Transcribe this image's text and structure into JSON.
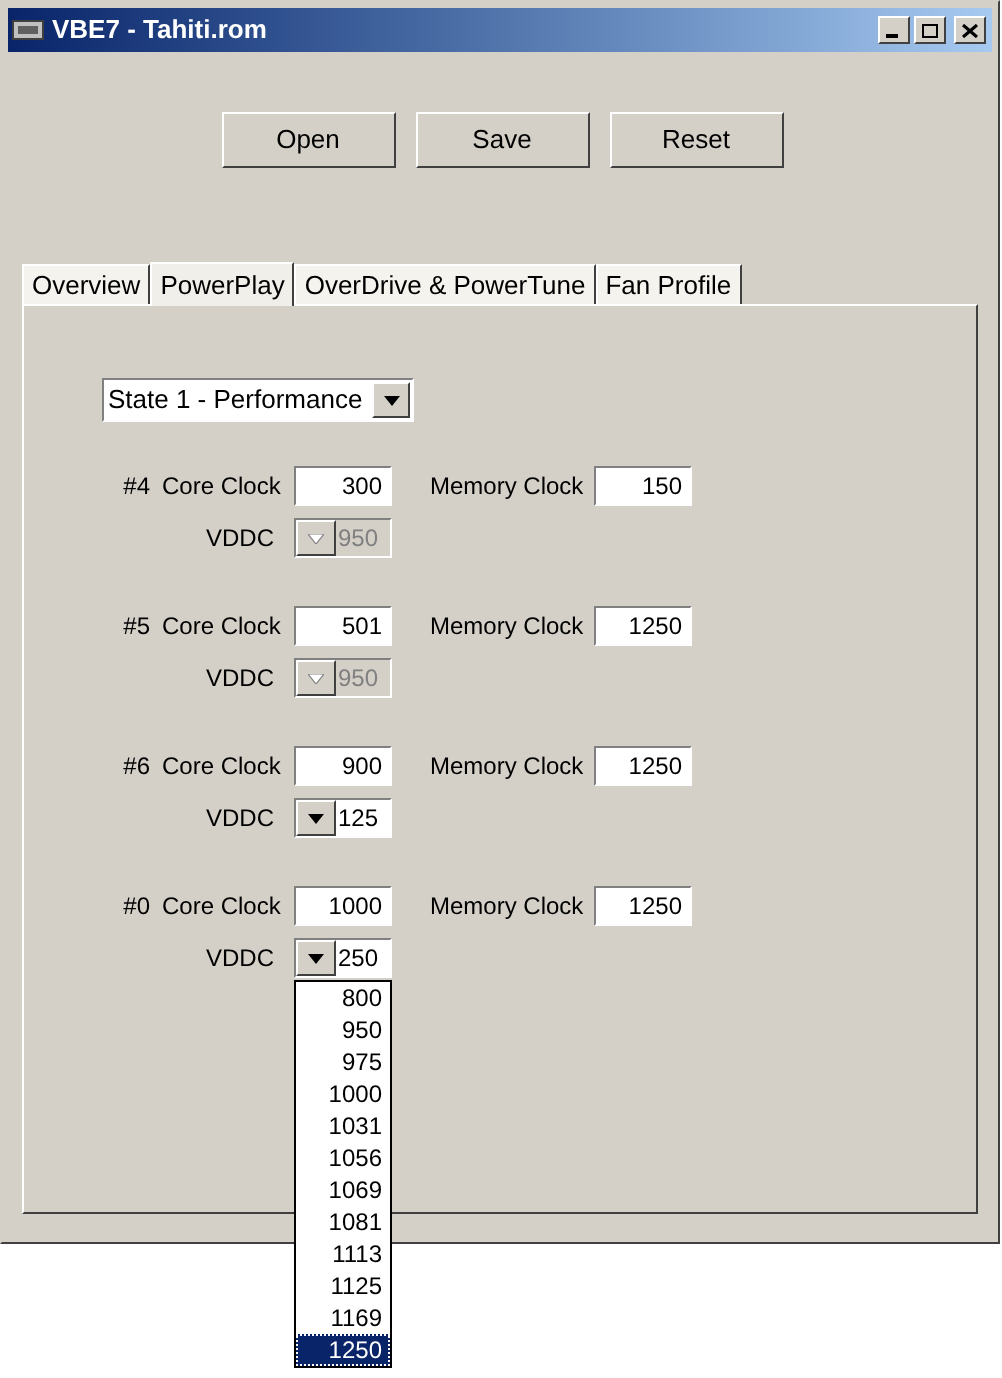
{
  "window": {
    "title": "VBE7 - Tahiti.rom"
  },
  "buttons": [
    "Open",
    "Save",
    "Reset"
  ],
  "tabs": [
    {
      "label": "Overview",
      "selected": false
    },
    {
      "label": "PowerPlay",
      "selected": true
    },
    {
      "label": "OverDrive & PowerTune",
      "selected": false
    },
    {
      "label": "Fan Profile",
      "selected": false
    }
  ],
  "state_select": {
    "value": "State 1 - Performance"
  },
  "states": [
    {
      "index": "#4",
      "core_label": "Core Clock",
      "core_clock": "300",
      "memory_label": "Memory Clock",
      "memory_clock": "150",
      "vddc_label": "VDDC",
      "vddc": "950",
      "disabled": true
    },
    {
      "index": "#5",
      "core_label": "Core Clock",
      "core_clock": "501",
      "memory_label": "Memory Clock",
      "memory_clock": "1250",
      "vddc_label": "VDDC",
      "vddc": "950",
      "disabled": true
    },
    {
      "index": "#6",
      "core_label": "Core Clock",
      "core_clock": "900",
      "memory_label": "Memory Clock",
      "memory_clock": "1250",
      "vddc_label": "VDDC",
      "vddc": "125",
      "disabled": false
    },
    {
      "index": "#0",
      "core_label": "Core Clock",
      "core_clock": "1000",
      "memory_label": "Memory Clock",
      "memory_clock": "1250",
      "vddc_label": "VDDC",
      "vddc": "250",
      "disabled": false,
      "options": [
        {
          "label": "800",
          "selected": false
        },
        {
          "label": "950",
          "selected": false
        },
        {
          "label": "975",
          "selected": false
        },
        {
          "label": "1000",
          "selected": false
        },
        {
          "label": "1031",
          "selected": false
        },
        {
          "label": "1056",
          "selected": false
        },
        {
          "label": "1069",
          "selected": false
        },
        {
          "label": "1081",
          "selected": false
        },
        {
          "label": "1113",
          "selected": false
        },
        {
          "label": "1125",
          "selected": false
        },
        {
          "label": "1169",
          "selected": false
        },
        {
          "label": "1250",
          "selected": true
        }
      ]
    }
  ]
}
